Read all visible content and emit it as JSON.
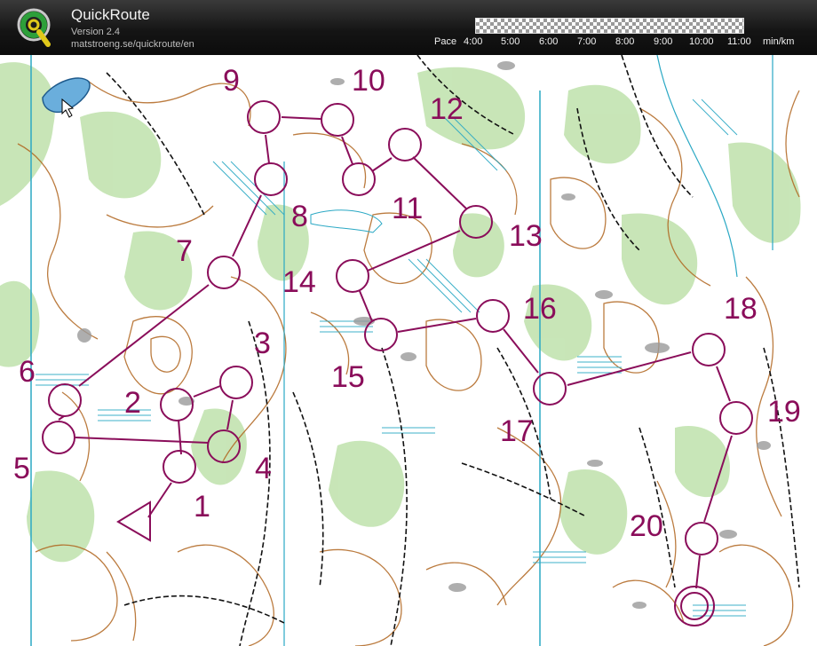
{
  "app": {
    "title": "QuickRoute",
    "version": "Version 2.4",
    "url": "matstroeng.se/quickroute/en"
  },
  "pace": {
    "label": "Pace",
    "ticks": [
      "4:00",
      "5:00",
      "6:00",
      "7:00",
      "8:00",
      "9:00",
      "10:00",
      "11:00"
    ],
    "unit": "min/km"
  },
  "course": {
    "color": "#8a0d5a",
    "controls": [
      "1",
      "2",
      "3",
      "4",
      "5",
      "6",
      "7",
      "8",
      "9",
      "10",
      "11",
      "12",
      "13",
      "14",
      "15",
      "16",
      "17",
      "18",
      "19",
      "20"
    ]
  },
  "colors": {
    "vegetation": "#b6dda0",
    "contours": "#b0651e",
    "water": "#2aa8c4",
    "paths": "#111111",
    "rock": "#9a9a9a"
  }
}
